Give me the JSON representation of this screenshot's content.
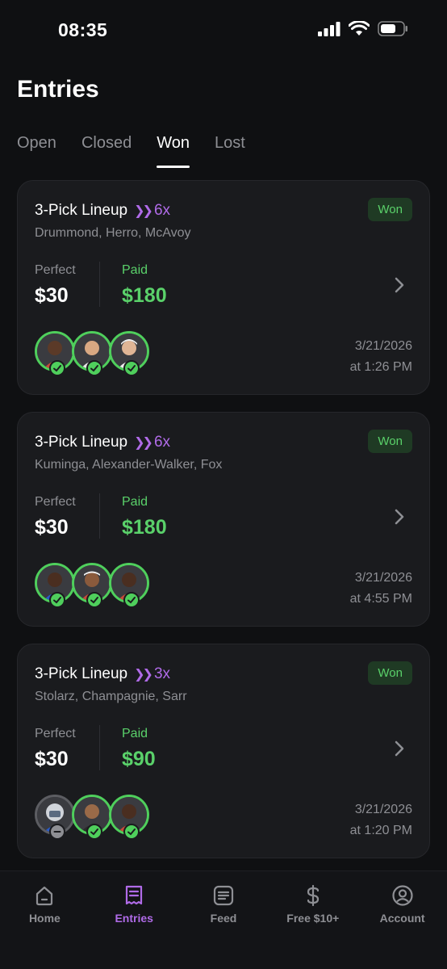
{
  "status_bar": {
    "time": "08:35"
  },
  "page": {
    "title": "Entries"
  },
  "tabs": [
    {
      "label": "Open",
      "active": false
    },
    {
      "label": "Closed",
      "active": false
    },
    {
      "label": "Won",
      "active": true
    },
    {
      "label": "Lost",
      "active": false
    }
  ],
  "cards": [
    {
      "title": "3-Pick Lineup",
      "multiplier": "6x",
      "players": "Drummond, Herro, McAvoy",
      "badge": "Won",
      "perfect_label": "Perfect",
      "perfect_value": "$30",
      "paid_label": "Paid",
      "paid_value": "$180",
      "date_line1": "3/21/2026",
      "date_line2": "at 1:26 PM"
    },
    {
      "title": "3-Pick Lineup",
      "multiplier": "6x",
      "players": "Kuminga, Alexander-Walker, Fox",
      "badge": "Won",
      "perfect_label": "Perfect",
      "perfect_value": "$30",
      "paid_label": "Paid",
      "paid_value": "$180",
      "date_line1": "3/21/2026",
      "date_line2": "at 4:55 PM"
    },
    {
      "title": "3-Pick Lineup",
      "multiplier": "3x",
      "players": "Stolarz, Champagnie, Sarr",
      "badge": "Won",
      "perfect_label": "Perfect",
      "perfect_value": "$30",
      "paid_label": "Paid",
      "paid_value": "$90",
      "date_line1": "3/21/2026",
      "date_line2": "at 1:20 PM"
    }
  ],
  "bottom_nav": [
    {
      "label": "Home",
      "icon": "home-icon",
      "active": false
    },
    {
      "label": "Entries",
      "icon": "receipt-icon",
      "active": true
    },
    {
      "label": "Feed",
      "icon": "feed-icon",
      "active": false
    },
    {
      "label": "Free $10+",
      "icon": "dollar-icon",
      "active": false
    },
    {
      "label": "Account",
      "icon": "account-icon",
      "active": false
    }
  ],
  "colors": {
    "background": "#0f1012",
    "card": "#1a1b1e",
    "won_green": "#5ad16a",
    "accent_purple": "#b06be8",
    "muted_text": "#8e8f94"
  }
}
